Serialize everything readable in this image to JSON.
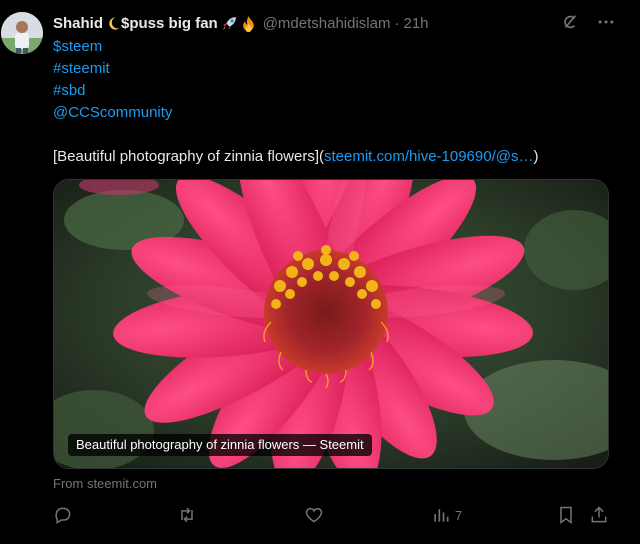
{
  "author": {
    "display_name": "Shahid",
    "display_name_suffix": "$puss big fan",
    "handle": "@mdetshahidislam",
    "separator": "·",
    "time": "21h"
  },
  "tweet": {
    "lines": [
      "$steem",
      "#steemit",
      "#sbd",
      "@CCScommunity"
    ],
    "body_prefix": "[Beautiful photography of zinnia flowers](",
    "body_link": "steemit.com/hive-109690/@s…",
    "body_suffix": ")"
  },
  "card": {
    "title": "Beautiful photography of zinnia flowers — Steemit",
    "source": "From steemit.com"
  },
  "actions": {
    "views_count": "7"
  },
  "icons": {
    "header": [
      "crescent-moon-icon",
      "rocket-icon",
      "fire-icon"
    ],
    "top": [
      "grok-icon",
      "more-icon"
    ],
    "action_bar": [
      "reply-icon",
      "retweet-icon",
      "like-icon",
      "views-icon",
      "bookmark-icon",
      "share-icon"
    ]
  },
  "colors": {
    "background": "#000000",
    "text": "#e7e9ea",
    "muted": "#71767b",
    "link": "#1d9bf0",
    "flower_petal": "#e8245f",
    "flower_center": "#f2b318"
  }
}
